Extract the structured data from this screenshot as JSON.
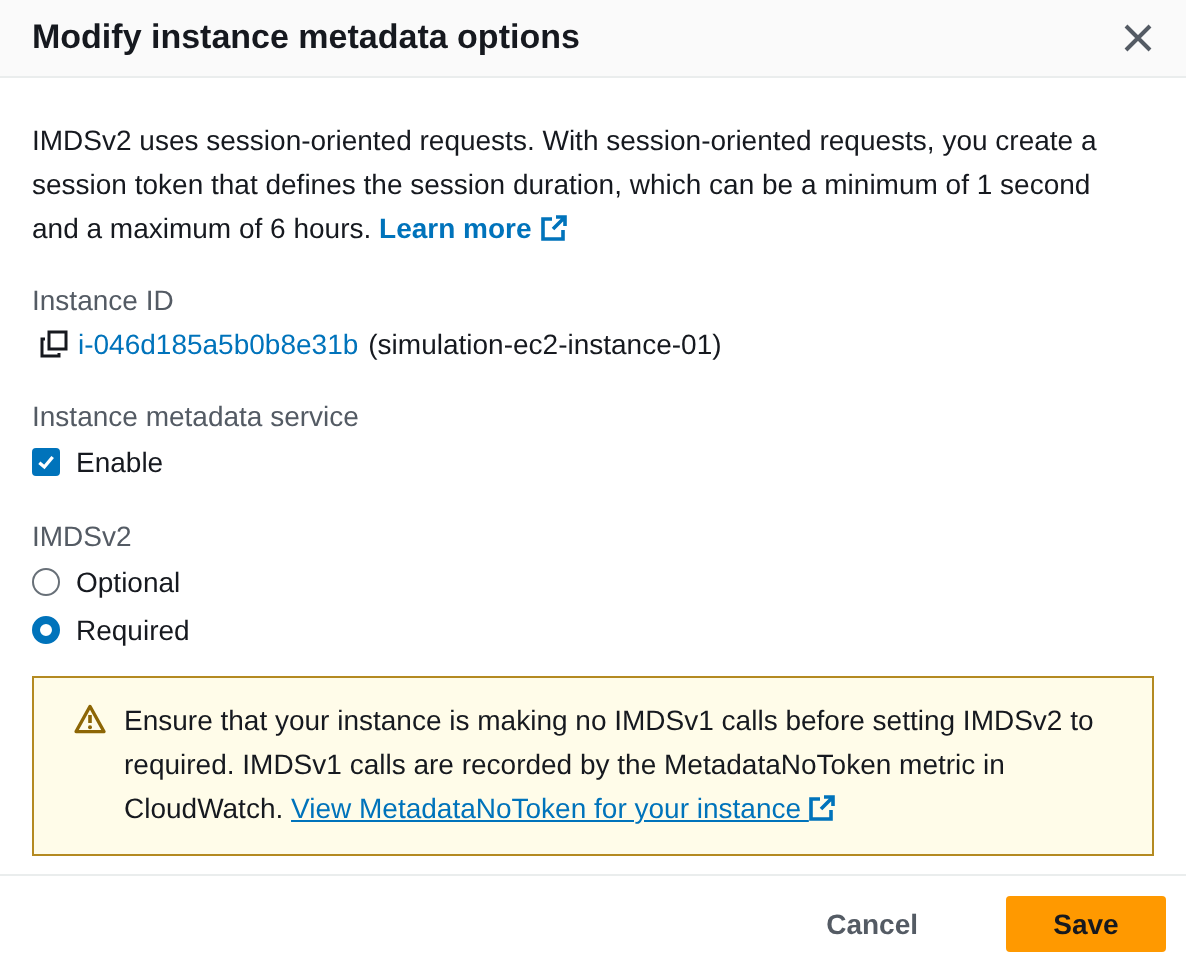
{
  "dialog": {
    "title": "Modify instance metadata options"
  },
  "intro": {
    "text": "IMDSv2 uses session-oriented requests. With session-oriented requests, you create a session token that defines the session duration, which can be a minimum of 1 second and a maximum of 6 hours.",
    "link": "Learn more"
  },
  "instance_id": {
    "label": "Instance ID",
    "id": "i-046d185a5b0b8e31b",
    "name": "(simulation-ec2-instance-01)"
  },
  "metadata_service": {
    "label": "Instance metadata service",
    "checkbox": {
      "label": "Enable",
      "checked": true
    }
  },
  "imdsv2": {
    "label": "IMDSv2",
    "options": [
      {
        "label": "Optional",
        "selected": false
      },
      {
        "label": "Required",
        "selected": true
      }
    ]
  },
  "alert": {
    "text": "Ensure that your instance is making no IMDSv1 calls before setting IMDSv2 to required. IMDSv1 calls are recorded by the MetadataNoToken metric in CloudWatch.",
    "link": "View MetadataNoToken for your instance"
  },
  "buttons": [
    {
      "label": "Cancel",
      "kind": "link"
    },
    {
      "label": "Save",
      "kind": "primary"
    }
  ]
}
